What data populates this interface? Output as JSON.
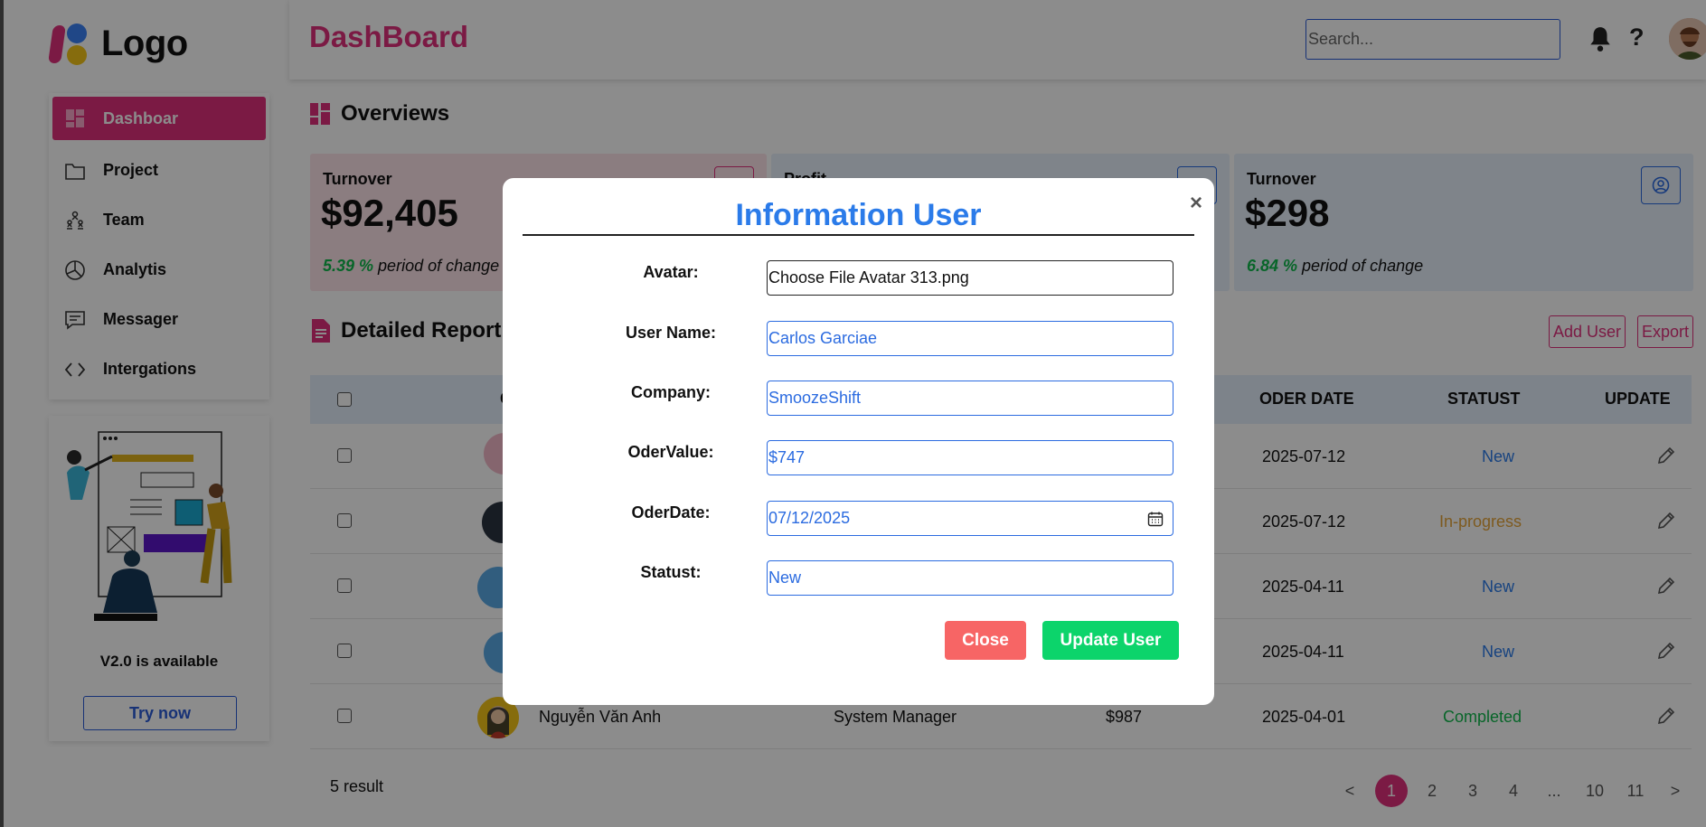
{
  "sidebar": {
    "logo_text": "Logo",
    "items": [
      {
        "label": "Dashboar",
        "icon": "dashboard-icon"
      },
      {
        "label": "Project",
        "icon": "folder-icon"
      },
      {
        "label": "Team",
        "icon": "team-icon"
      },
      {
        "label": "Analytis",
        "icon": "pie-chart-icon"
      },
      {
        "label": "Messager",
        "icon": "message-icon"
      },
      {
        "label": "Intergations",
        "icon": "code-icon"
      }
    ],
    "promo": {
      "title": "V2.0 is available",
      "button": "Try now"
    }
  },
  "header": {
    "title": "DashBoard",
    "search_placeholder": "Search...",
    "help_label": "?"
  },
  "overview": {
    "title": "Overviews",
    "cards": [
      {
        "label": "Turnover",
        "value": "$92,405",
        "change": "5.39 %",
        "change_text": " period of change",
        "bg": "#fde4ea"
      },
      {
        "label": "Profit",
        "value": "",
        "change": "",
        "change_text": "",
        "bg": "#e7f0fc"
      },
      {
        "label": "Turnover",
        "value": "$298",
        "change": "6.84 %",
        "change_text": " period of change",
        "bg": "#e7f0fc"
      }
    ]
  },
  "report": {
    "title": "Detailed Report",
    "add_user": "Add User",
    "export": "Export",
    "columns": {
      "customer": "C",
      "oder_date": "ODER DATE",
      "statust": "STATUST",
      "update": "UPDATE"
    },
    "rows": [
      {
        "name": "",
        "company": "",
        "value": "",
        "date": "2025-07-12",
        "status": "New",
        "status_color": "#2b7be9"
      },
      {
        "name": "",
        "company": "",
        "value": "",
        "date": "2025-07-12",
        "status": "In-progress",
        "status_color": "#e5a53a"
      },
      {
        "name": "",
        "company": "",
        "value": "",
        "date": "2025-04-11",
        "status": "New",
        "status_color": "#2b7be9"
      },
      {
        "name": "",
        "company": "",
        "value": "",
        "date": "2025-04-11",
        "status": "New",
        "status_color": "#2b7be9"
      },
      {
        "name": "Nguyễn Văn Anh",
        "company": "System Manager",
        "value": "$987",
        "date": "2025-04-01",
        "status": "Completed",
        "status_color": "#0fb94b"
      }
    ],
    "result_text": "5 result",
    "pagination": [
      "<",
      "1",
      "2",
      "3",
      "4",
      "...",
      "10",
      "11",
      ">"
    ],
    "active_page": "1"
  },
  "modal": {
    "title": "Information User",
    "close_symbol": "×",
    "fields": {
      "avatar_label": "Avatar:",
      "avatar_value": "Choose File Avatar 313.png",
      "username_label": "User Name:",
      "username_value": "Carlos Garciae",
      "company_label": "Company:",
      "company_value": "SmoozeShift",
      "odervalue_label": "OderValue:",
      "odervalue_value": "$747",
      "oderdate_label": "OderDate:",
      "oderdate_value": "07/12/2025",
      "statust_label": "Statust:",
      "statust_value": "New"
    },
    "close_button": "Close",
    "update_button": "Update User"
  }
}
